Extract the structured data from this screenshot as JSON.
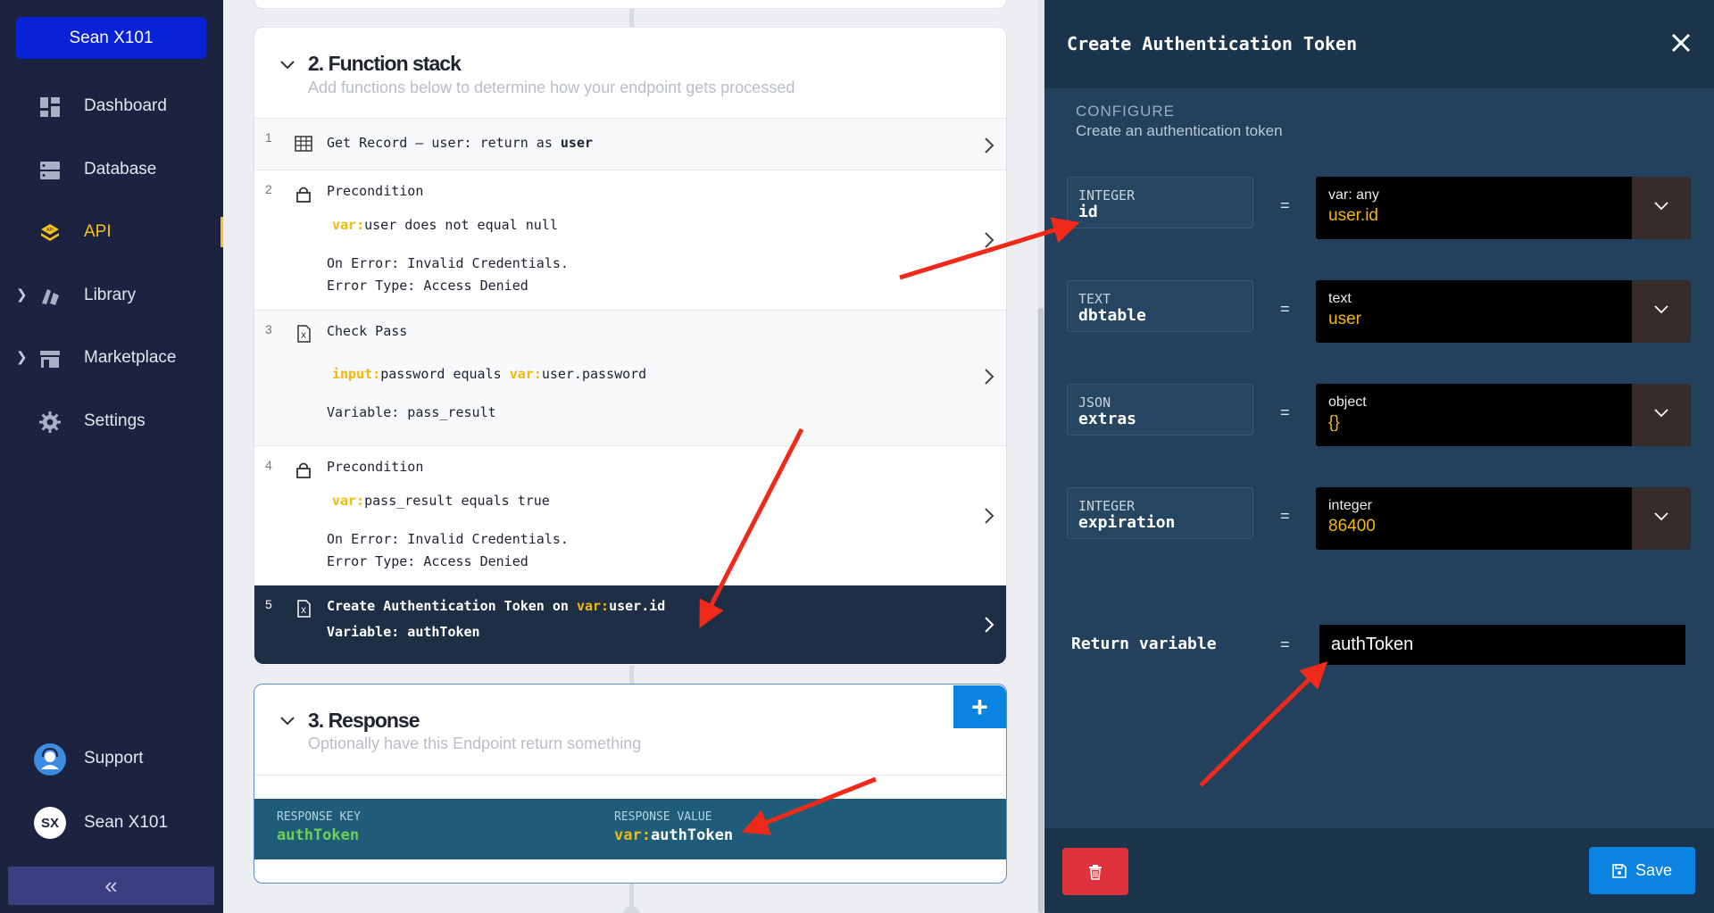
{
  "sidebar": {
    "workspace": "Sean X101",
    "items": [
      {
        "label": "Dashboard",
        "icon": "dashboard-icon"
      },
      {
        "label": "Database",
        "icon": "database-icon"
      },
      {
        "label": "API",
        "icon": "api-icon"
      },
      {
        "label": "Library",
        "icon": "library-icon"
      },
      {
        "label": "Marketplace",
        "icon": "marketplace-icon"
      },
      {
        "label": "Settings",
        "icon": "gear-icon"
      }
    ],
    "support": "Support",
    "user_initials": "SX",
    "user_name": "Sean X101",
    "collapse_glyph": "«"
  },
  "function_stack": {
    "title": "2. Function stack",
    "subtitle": "Add functions below to determine how your endpoint gets processed",
    "steps": [
      {
        "num": "1",
        "title": "Get Record – user: return as",
        "title_bold": "user"
      },
      {
        "num": "2",
        "title": "Precondition",
        "prefix": "var:",
        "expr": "user does not equal null",
        "error": "On Error: Invalid Credentials.",
        "error_type": "Error Type: Access Denied"
      },
      {
        "num": "3",
        "title": "Check Pass",
        "prefix1": "input:",
        "expr1": "password equals",
        "prefix2": "var:",
        "expr2": "user.password",
        "variable": "Variable: pass_result"
      },
      {
        "num": "4",
        "title": "Precondition",
        "prefix": "var:",
        "expr": "pass_result equals true",
        "error": "On Error: Invalid Credentials.",
        "error_type": "Error Type: Access Denied"
      },
      {
        "num": "5",
        "title": "Create Authentication Token on",
        "prefix": "var:",
        "expr": "user.id",
        "variable": "Variable: authToken"
      }
    ]
  },
  "response": {
    "title": "3. Response",
    "subtitle": "Optionally have this Endpoint return something",
    "add_label": "+",
    "key_label": "RESPONSE KEY",
    "key_value": "authToken",
    "value_label": "RESPONSE VALUE",
    "value_prefix": "var:",
    "value_value": "authToken"
  },
  "panel": {
    "title": "Create Authentication Token",
    "section": "CONFIGURE",
    "section_sub": "Create an authentication token",
    "params": [
      {
        "type": "INTEGER",
        "name": "id",
        "eq": "=",
        "value_type": "var: any",
        "value": "user.id"
      },
      {
        "type": "TEXT",
        "name": "dbtable",
        "eq": "=",
        "value_type": "text",
        "value": "user"
      },
      {
        "type": "JSON",
        "name": "extras",
        "eq": "=",
        "value_type": "object",
        "value": "{}"
      },
      {
        "type": "INTEGER",
        "name": "expiration",
        "eq": "=",
        "value_type": "integer",
        "value": "86400"
      }
    ],
    "return_label": "Return variable",
    "return_eq": "=",
    "return_value": "authToken",
    "save_label": "Save"
  },
  "colors": {
    "sidebar_bg": "#1c2340",
    "accent_yellow": "#f0b90b",
    "panel_bg": "#23405c",
    "primary_blue": "#0a84e0",
    "danger_red": "#e0323c",
    "annotation_red": "#f02a1a"
  }
}
